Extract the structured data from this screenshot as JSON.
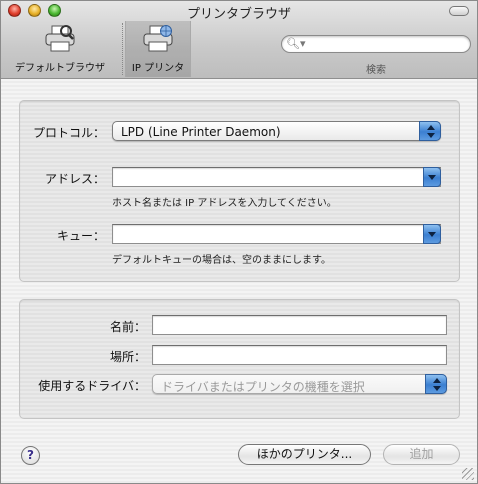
{
  "window": {
    "title": "プリンタブラウザ"
  },
  "toolbar": {
    "default_browser_label": "デフォルトブラウザ",
    "ip_printer_label": "IP プリンタ",
    "search_label": "検索",
    "search_value": ""
  },
  "protocol_section": {
    "protocol_label": "プロトコル：",
    "protocol_value": "LPD (Line Printer Daemon)",
    "address_label": "アドレス：",
    "address_value": "",
    "address_hint": "ホスト名または IP アドレスを入力してください。",
    "queue_label": "キュー：",
    "queue_value": "",
    "queue_hint": "デフォルトキューの場合は、空のままにします。"
  },
  "printer_section": {
    "name_label": "名前：",
    "name_value": "",
    "location_label": "場所：",
    "location_value": "",
    "driver_label": "使用するドライバ：",
    "driver_value": "ドライバまたはプリンタの機種を選択"
  },
  "footer": {
    "help_label": "?",
    "other_printers_label": "ほかのプリンタ...",
    "add_label": "追加"
  },
  "colors": {
    "accent": "#3b7fd1",
    "disabled_text": "#9a9a9a"
  }
}
